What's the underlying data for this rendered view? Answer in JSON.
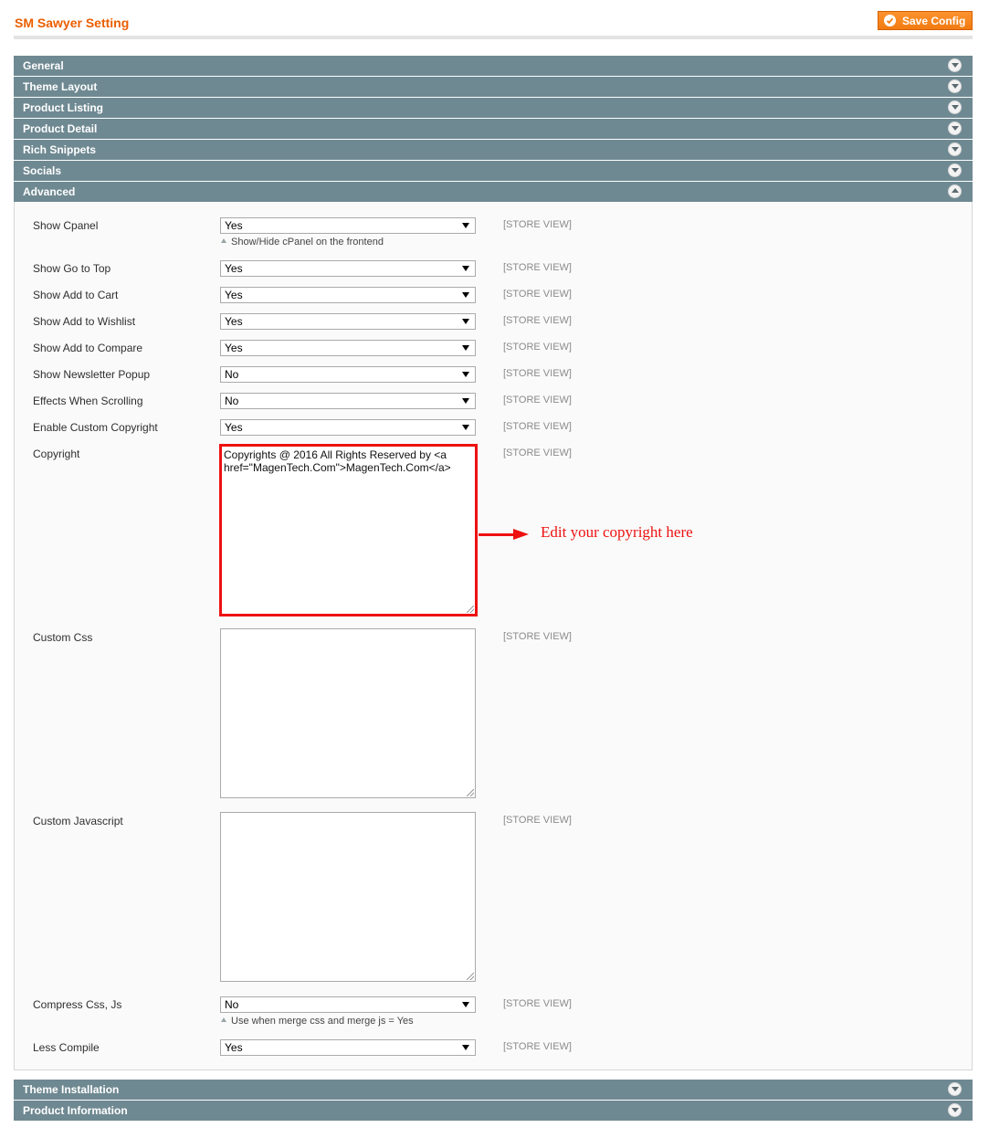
{
  "header": {
    "title": "SM Sawyer Setting",
    "save_label": "Save Config"
  },
  "sections": {
    "general": "General",
    "theme_layout": "Theme Layout",
    "product_listing": "Product Listing",
    "product_detail": "Product Detail",
    "rich_snippets": "Rich Snippets",
    "socials": "Socials",
    "advanced": "Advanced",
    "theme_installation": "Theme Installation",
    "product_information": "Product Information"
  },
  "scope_label": "[STORE VIEW]",
  "advanced": {
    "show_cpanel": {
      "label": "Show Cpanel",
      "value": "Yes",
      "note": "Show/Hide cPanel on the frontend"
    },
    "show_go_to_top": {
      "label": "Show Go to Top",
      "value": "Yes"
    },
    "show_add_to_cart": {
      "label": "Show Add to Cart",
      "value": "Yes"
    },
    "show_add_to_wishlist": {
      "label": "Show Add to Wishlist",
      "value": "Yes"
    },
    "show_add_to_compare": {
      "label": "Show Add to Compare",
      "value": "Yes"
    },
    "show_newsletter_popup": {
      "label": "Show Newsletter Popup",
      "value": "No"
    },
    "effects_when_scrolling": {
      "label": "Effects When Scrolling",
      "value": "No"
    },
    "enable_custom_copyright": {
      "label": "Enable Custom Copyright",
      "value": "Yes"
    },
    "copyright": {
      "label": "Copyright",
      "value": "Copyrights @ 2016 All Rights Reserved by <a href=\"MagenTech.Com\">MagenTech.Com</a>"
    },
    "custom_css": {
      "label": "Custom Css",
      "value": ""
    },
    "custom_javascript": {
      "label": "Custom Javascript",
      "value": ""
    },
    "compress_css_js": {
      "label": "Compress Css, Js",
      "value": "No",
      "note": "Use when merge css and merge js = Yes"
    },
    "less_compile": {
      "label": "Less Compile",
      "value": "Yes"
    }
  },
  "annotation": {
    "text": "Edit your copyright here",
    "color": "#ee1111"
  },
  "colors": {
    "title": "#eb5e00",
    "section_header": "#6f8992",
    "save_button": "#f37b10"
  }
}
